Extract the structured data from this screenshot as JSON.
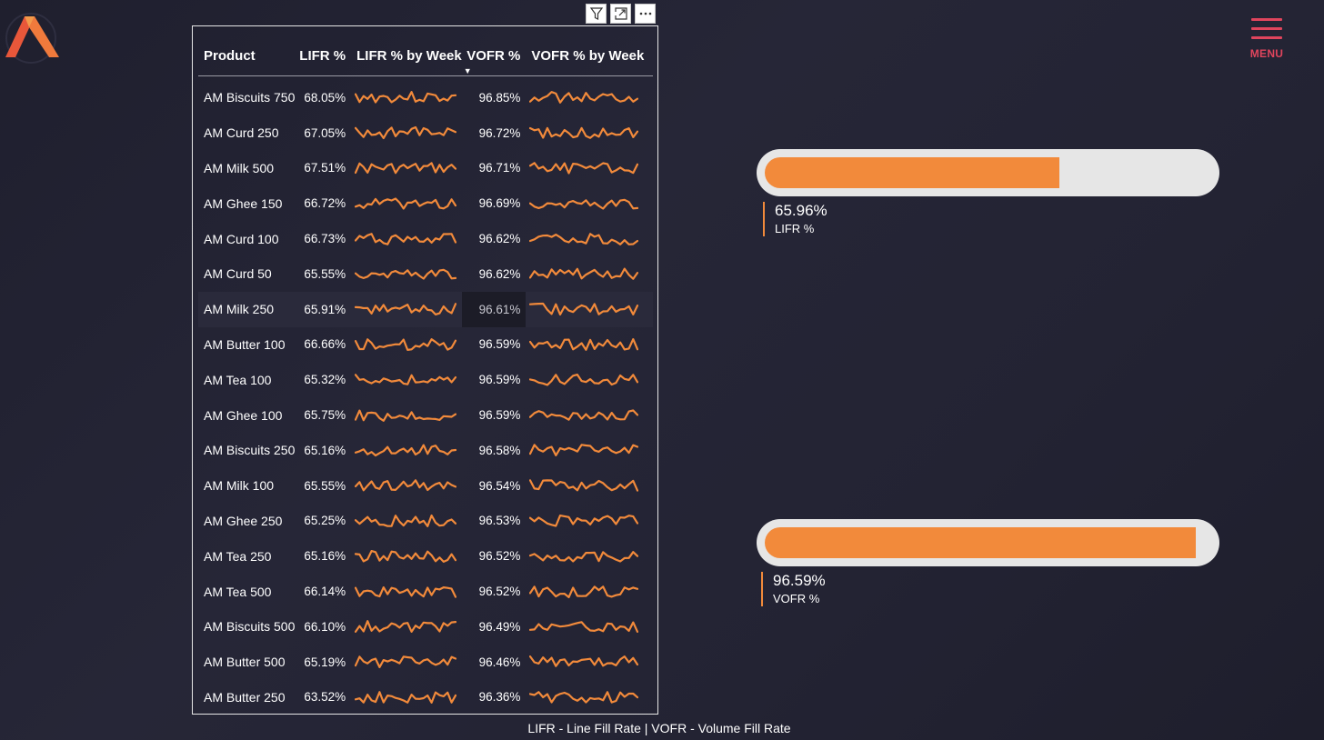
{
  "menu": {
    "label": "MENU"
  },
  "table": {
    "headers": {
      "product": "Product",
      "lifr": "LIFR %",
      "lifr_week": "LIFR % by Week",
      "vofr": "VOFR %",
      "vofr_week": "VOFR % by Week"
    },
    "rows": [
      {
        "product": "AM Biscuits 750",
        "lifr": "68.05%",
        "vofr": "96.85%"
      },
      {
        "product": "AM Curd 250",
        "lifr": "67.05%",
        "vofr": "96.72%"
      },
      {
        "product": "AM Milk 500",
        "lifr": "67.51%",
        "vofr": "96.71%"
      },
      {
        "product": "AM Ghee 150",
        "lifr": "66.72%",
        "vofr": "96.69%"
      },
      {
        "product": "AM Curd 100",
        "lifr": "66.73%",
        "vofr": "96.62%"
      },
      {
        "product": "AM Curd 50",
        "lifr": "65.55%",
        "vofr": "96.62%"
      },
      {
        "product": "AM Milk 250",
        "lifr": "65.91%",
        "vofr": "96.61%"
      },
      {
        "product": "AM Butter 100",
        "lifr": "66.66%",
        "vofr": "96.59%"
      },
      {
        "product": "AM Tea 100",
        "lifr": "65.32%",
        "vofr": "96.59%"
      },
      {
        "product": "AM Ghee 100",
        "lifr": "65.75%",
        "vofr": "96.59%"
      },
      {
        "product": "AM Biscuits 250",
        "lifr": "65.16%",
        "vofr": "96.58%"
      },
      {
        "product": "AM Milk 100",
        "lifr": "65.55%",
        "vofr": "96.54%"
      },
      {
        "product": "AM Ghee 250",
        "lifr": "65.25%",
        "vofr": "96.53%"
      },
      {
        "product": "AM Tea 250",
        "lifr": "65.16%",
        "vofr": "96.52%"
      },
      {
        "product": "AM Tea 500",
        "lifr": "66.14%",
        "vofr": "96.52%"
      },
      {
        "product": "AM Biscuits 500",
        "lifr": "66.10%",
        "vofr": "96.49%"
      },
      {
        "product": "AM Butter 500",
        "lifr": "65.19%",
        "vofr": "96.46%"
      },
      {
        "product": "AM Butter 250",
        "lifr": "63.52%",
        "vofr": "96.36%"
      }
    ]
  },
  "kpis": [
    {
      "value": "65.96%",
      "label": "LIFR %",
      "fraction": 0.6596
    },
    {
      "value": "96.59%",
      "label": "VOFR %",
      "fraction": 0.9659
    }
  ],
  "footnote": "LIFR - Line Fill Rate | VOFR - Volume Fill Rate",
  "colors": {
    "accent": "#f28a3b",
    "menu": "#e0455d",
    "gauge_track": "#e6e6e6"
  },
  "icons": [
    "logo-icon",
    "menu-icon",
    "filter-icon",
    "focus-mode-icon",
    "more-options-icon",
    "sort-descending-icon"
  ]
}
